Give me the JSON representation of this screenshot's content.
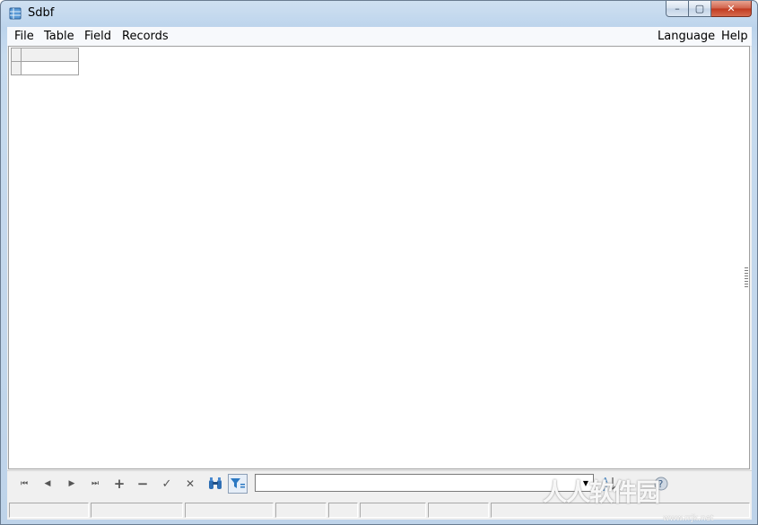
{
  "window": {
    "title": "Sdbf",
    "controls": {
      "minimize": "–",
      "maximize": "▢",
      "close": "✕"
    }
  },
  "menubar": {
    "left": [
      "File",
      "Table",
      "Field",
      "Records"
    ],
    "right": [
      "Language",
      "Help"
    ]
  },
  "toolbar": {
    "nav": {
      "first": "⏮",
      "prior": "◀",
      "next": "▶",
      "last": "⏭"
    },
    "edit": {
      "insert": "+",
      "delete": "−",
      "post": "✓",
      "cancel": "✕"
    },
    "icons": [
      "first-record-icon",
      "prior-record-icon",
      "next-record-icon",
      "last-record-icon",
      "insert-record-icon",
      "delete-record-icon",
      "post-record-icon",
      "cancel-record-icon",
      "binoculars-icon",
      "filter-icon",
      "sort-az-icon",
      "help-icon"
    ],
    "combo_value": "",
    "combo_arrow": "▼"
  },
  "colors": {
    "accent": "#2b78c2",
    "frame": "#bcd4ec",
    "close": "#c7432a"
  },
  "watermark": {
    "text": "人人软件园",
    "url": "www.rrjk.net"
  }
}
